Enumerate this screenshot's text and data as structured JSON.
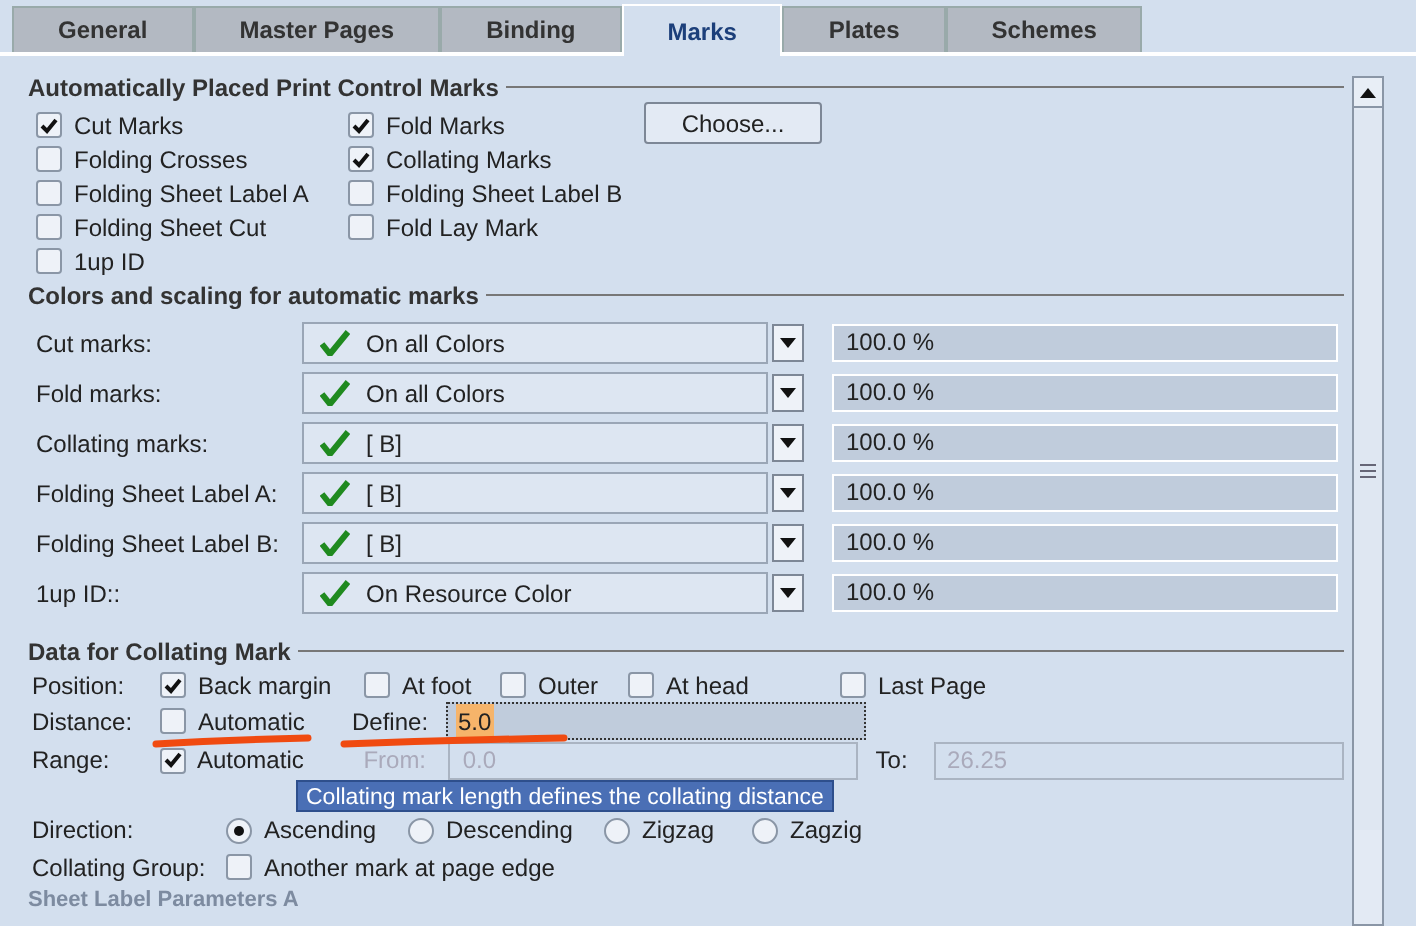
{
  "tabs": [
    {
      "label": "General",
      "selected": false
    },
    {
      "label": "Master Pages",
      "selected": false
    },
    {
      "label": "Binding",
      "selected": false
    },
    {
      "label": "Marks",
      "selected": true
    },
    {
      "label": "Plates",
      "selected": false
    },
    {
      "label": "Schemes",
      "selected": false
    }
  ],
  "auto_marks": {
    "title": "Automatically Placed Print Control Marks",
    "choose_button": "Choose...",
    "checkboxes": [
      {
        "label": "Cut Marks",
        "checked": true
      },
      {
        "label": "Fold Marks",
        "checked": true
      },
      {
        "label": "Folding Crosses",
        "checked": false
      },
      {
        "label": "Collating Marks",
        "checked": true
      },
      {
        "label": "Folding Sheet Label A",
        "checked": false
      },
      {
        "label": "Folding Sheet Label B",
        "checked": false
      },
      {
        "label": "Folding Sheet Cut",
        "checked": false
      },
      {
        "label": "Fold Lay Mark",
        "checked": false
      },
      {
        "label": "1up ID",
        "checked": false
      }
    ]
  },
  "colors_scaling": {
    "title": "Colors and scaling for automatic marks",
    "rows": [
      {
        "label": "Cut marks:",
        "color_setting": "On all Colors",
        "scale": "100.0 %"
      },
      {
        "label": "Fold marks:",
        "color_setting": "On all Colors",
        "scale": "100.0 %"
      },
      {
        "label": "Collating marks:",
        "color_setting": "[ B]",
        "scale": "100.0 %"
      },
      {
        "label": "Folding Sheet Label A:",
        "color_setting": "[ B]",
        "scale": "100.0 %"
      },
      {
        "label": "Folding Sheet Label B:",
        "color_setting": "[ B]",
        "scale": "100.0 %"
      },
      {
        "label": "1up ID::",
        "color_setting": "On Resource Color",
        "scale": "100.0 %"
      }
    ]
  },
  "collating": {
    "title": "Data for Collating Mark",
    "position": {
      "label": "Position:",
      "options": [
        {
          "label": "Back margin",
          "checked": true
        },
        {
          "label": "At foot",
          "checked": false
        },
        {
          "label": "Outer",
          "checked": false
        },
        {
          "label": "At head",
          "checked": false
        },
        {
          "label": "Last Page",
          "checked": false
        }
      ]
    },
    "distance": {
      "label": "Distance:",
      "automatic": {
        "label": "Automatic",
        "checked": false
      },
      "define_label": "Define:",
      "define_value": "5.0"
    },
    "range": {
      "label": "Range:",
      "automatic": {
        "label": "Automatic",
        "checked": true
      },
      "from_label": "From:",
      "from_value": "0.0",
      "to_label": "To:",
      "to_value": "26.25",
      "disabled": true
    },
    "direction": {
      "label": "Direction:",
      "options": [
        {
          "label": "Ascending",
          "selected": true
        },
        {
          "label": "Descending",
          "selected": false
        },
        {
          "label": "Zigzag",
          "selected": false
        },
        {
          "label": "Zagzig",
          "selected": false
        }
      ]
    },
    "collating_group": {
      "label": "Collating Group:",
      "option": {
        "label": "Another mark at page edge",
        "checked": false
      }
    }
  },
  "next_section": {
    "title": "Sheet Label Parameters A"
  },
  "tooltip": "Collating mark length defines the collating distance"
}
